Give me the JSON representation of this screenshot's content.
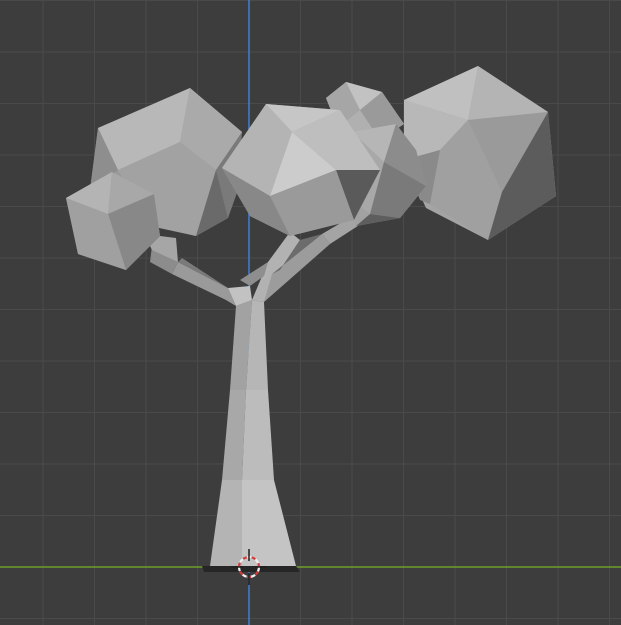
{
  "viewport": {
    "view": "front-orthographic",
    "colors": {
      "background": "#3d3d3d",
      "grid_line": "#4a4a4a",
      "axis_x": "#6f9e2c",
      "axis_z": "#3f7fd6",
      "cursor_red": "#d23c3c",
      "cursor_white": "#f0f0f0",
      "ground_shadow": "#262626"
    }
  },
  "scene": {
    "objects": [
      {
        "name": "trunk",
        "kind": "mesh"
      },
      {
        "name": "branches",
        "kind": "mesh"
      },
      {
        "name": "foliage",
        "kind": "mesh",
        "count": 6
      }
    ],
    "shading": {
      "lightest": "#c9c9c9",
      "light": "#b0b0b0",
      "mid": "#969696",
      "dark": "#767676",
      "darkest": "#555555"
    }
  },
  "cursor": {
    "icon": "3d-cursor-icon"
  }
}
